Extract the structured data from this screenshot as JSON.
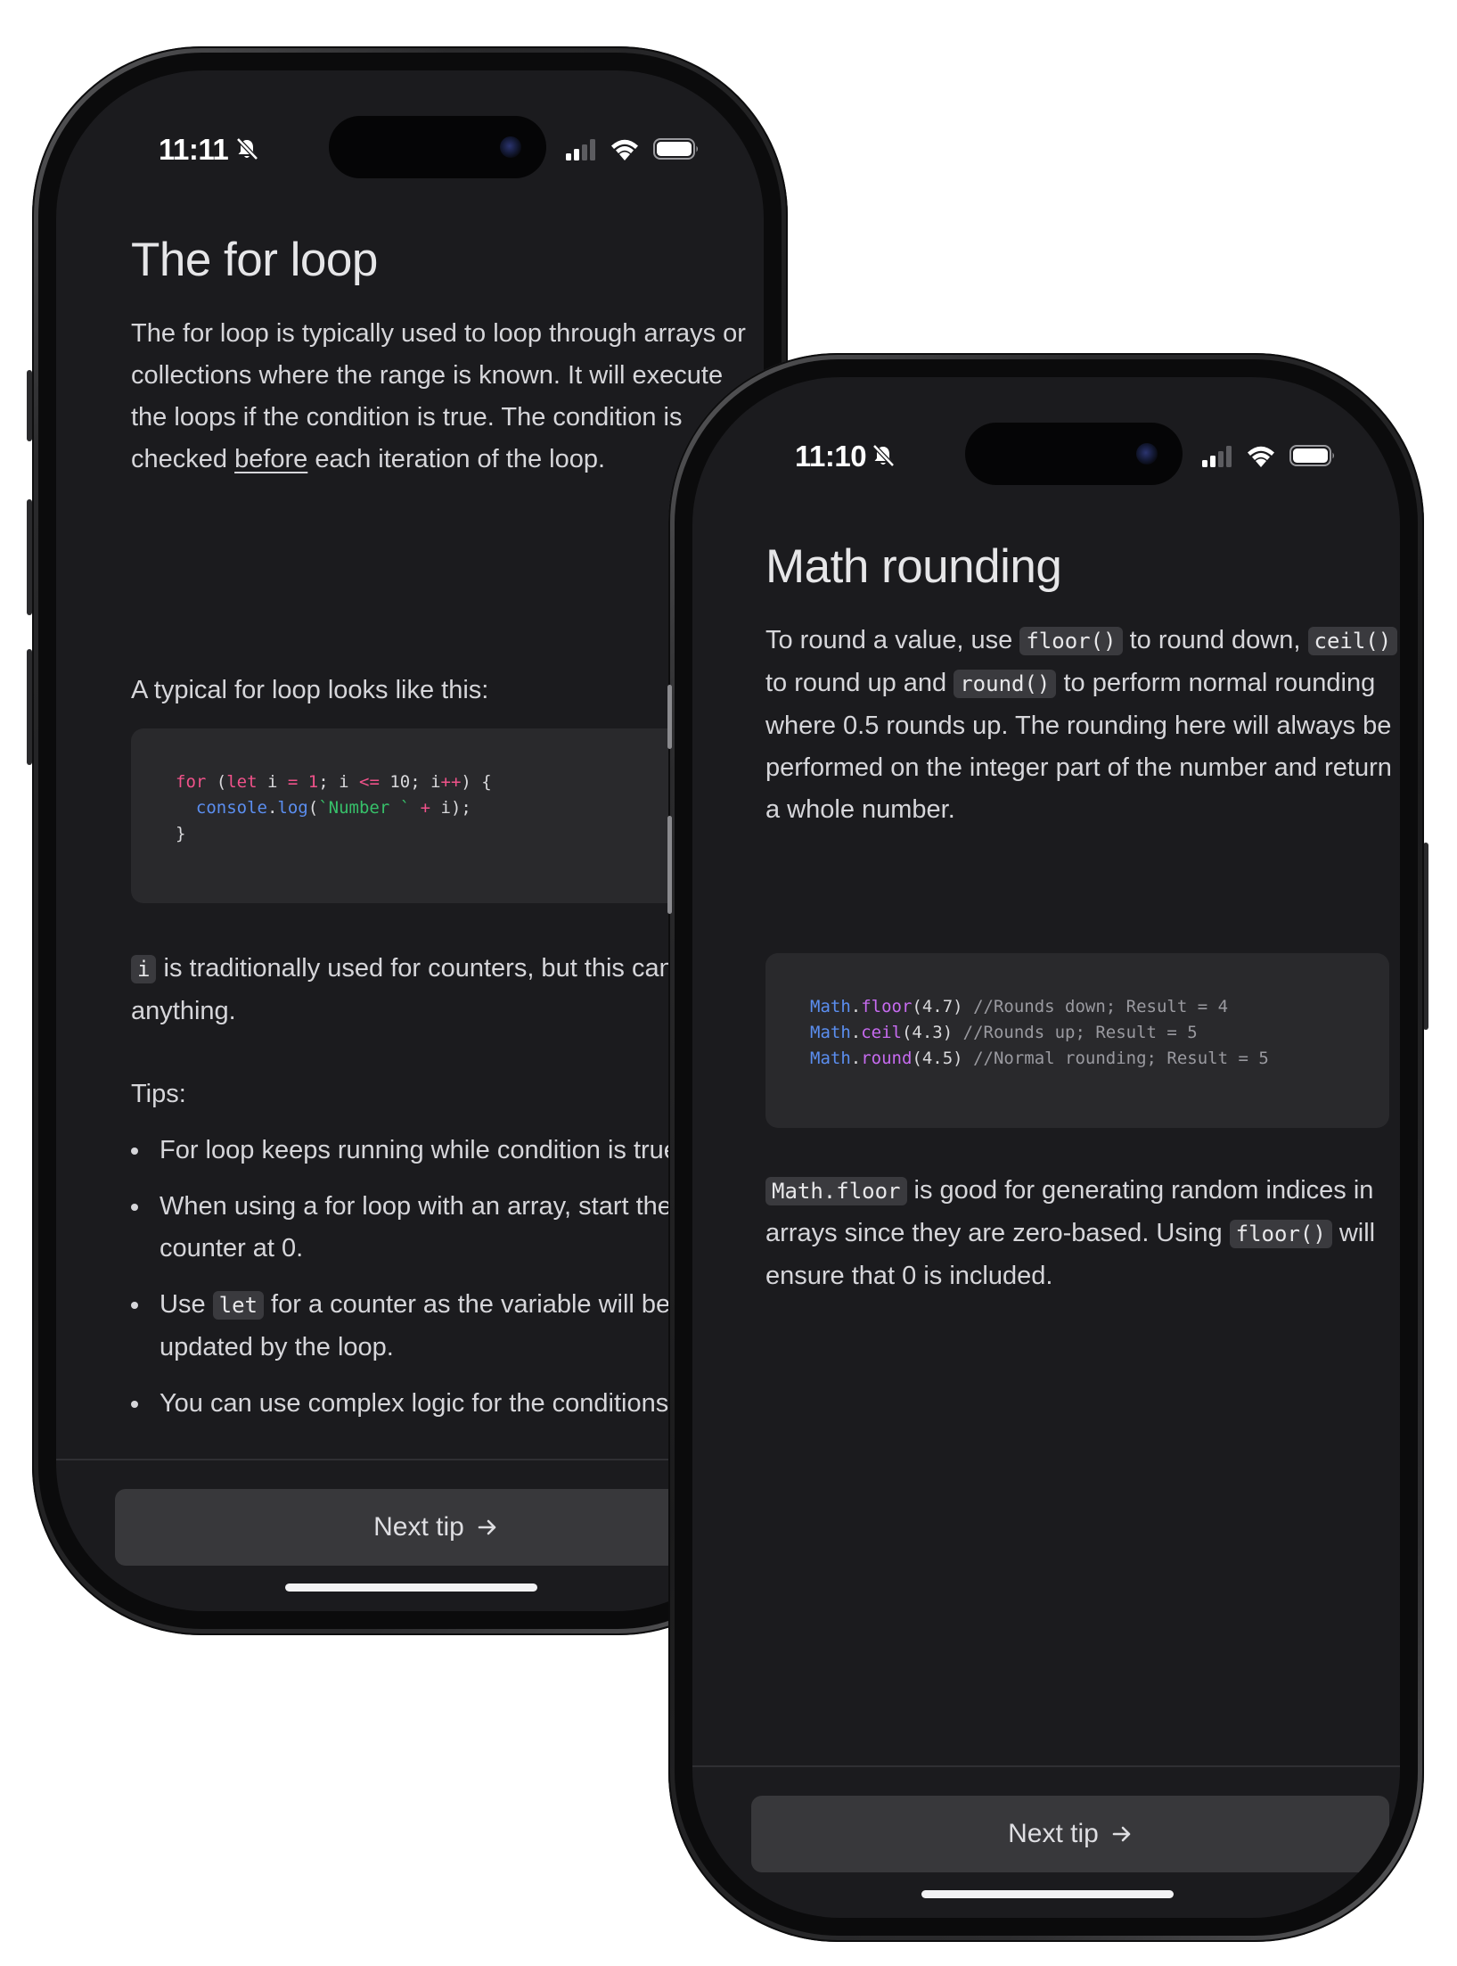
{
  "phone_left": {
    "status": {
      "time": "11:11"
    },
    "title": "The for loop",
    "intro": {
      "part1": "The for loop is typically used to loop through arrays or collections where the range is known. It will execute the loops if the condition is true. The condition is checked ",
      "emphasis": "before",
      "part2": " each iteration of the loop."
    },
    "typical": "A typical for loop looks like this:",
    "code_lines": [
      "for (let i = 1; i <= 10; i++) {",
      "  console.log(`Number ` + i);",
      "}"
    ],
    "counter_note": {
      "code": "i",
      "text": " is traditionally used for counters, but this can be anything."
    },
    "tips_label": "Tips:",
    "tips": [
      {
        "text": "For loop keeps running while condition is true"
      },
      {
        "text": "When using a for loop with an array, start the counter at 0."
      },
      {
        "pre": "Use ",
        "code": "let",
        "post": " for a counter as the variable will be updated by the loop."
      },
      {
        "text": "You can use complex logic for the conditions"
      }
    ],
    "button": {
      "label": "Next tip",
      "icon": "arrow-right-icon"
    }
  },
  "phone_right": {
    "status": {
      "time": "11:10"
    },
    "title": "Math rounding",
    "intro": {
      "t1": "To round a value, use ",
      "c1": "floor()",
      "t2": " to round down, ",
      "c2": "ceil()",
      "t3": " to round up and ",
      "c3": "round()",
      "t4": " to perform normal rounding where 0.5 rounds up. The rounding here will always be performed on the integer part of the number and return a whole number."
    },
    "code_lines": [
      "Math.floor(4.7) //Rounds down; Result = 4",
      "Math.ceil(4.3) //Rounds up; Result = 5",
      "Math.round(4.5) //Normal rounding; Result = 5"
    ],
    "note": {
      "c1": "Math.floor",
      "t1": " is good for generating random indices in arrays since they are zero-based. Using ",
      "c2": "floor()",
      "t2": " will ensure that 0 is included."
    },
    "button": {
      "label": "Next tip",
      "icon": "arrow-right-icon"
    }
  },
  "colors": {
    "screen_bg": "#1b1b1e",
    "code_bg": "#29292c",
    "button_bg": "#38383b",
    "keyword": "#f0528a",
    "function": "#5b8ef0",
    "string": "#37c06a"
  }
}
